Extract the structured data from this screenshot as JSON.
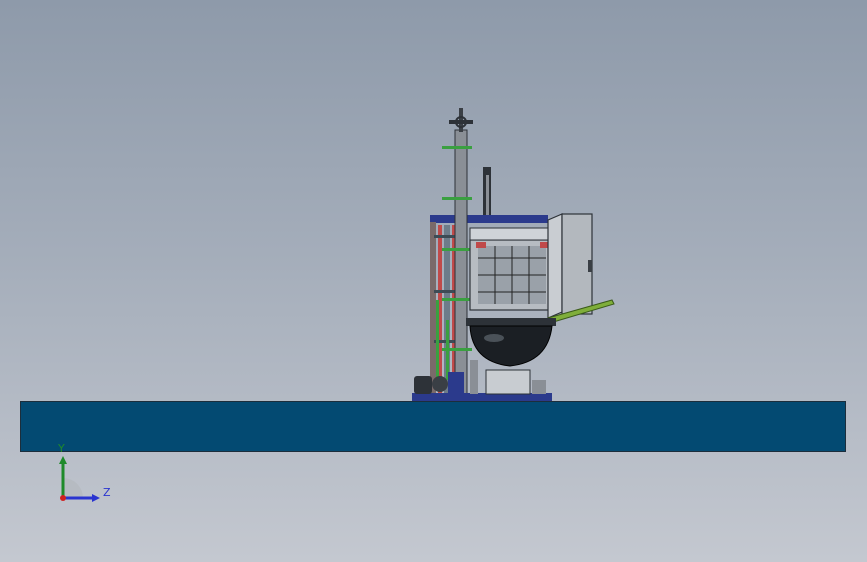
{
  "view": {
    "background_top": "#8e9aaa",
    "background_bottom": "#c4c8d0",
    "floor_color": "#034a72"
  },
  "triad": {
    "y_label": "Y",
    "z_label": "Z",
    "y_color": "#1e8a2a",
    "z_color": "#2a34d0",
    "x_color": "#d02020"
  }
}
